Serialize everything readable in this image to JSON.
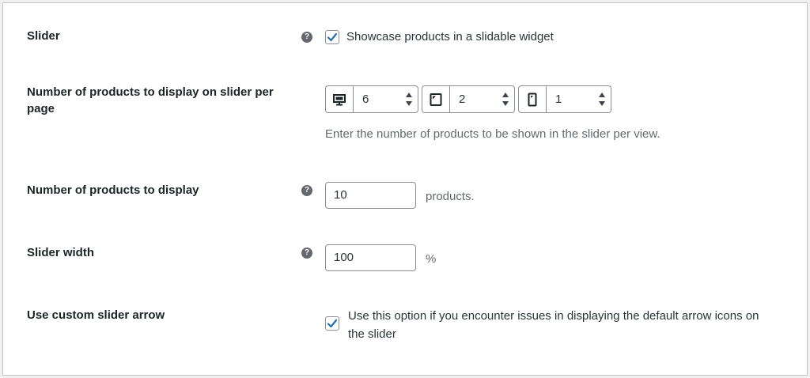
{
  "slider": {
    "label": "Slider",
    "help_glyph": "?",
    "checked": true,
    "checkbox_label": "Showcase products in a slidable widget"
  },
  "per_page": {
    "label": "Number of products to display on slider per page",
    "desktop": {
      "icon": "desktop-icon",
      "value": "6"
    },
    "tablet": {
      "icon": "tablet-icon",
      "value": "2"
    },
    "mobile": {
      "icon": "mobile-icon",
      "value": "1"
    },
    "description": "Enter the number of products to be shown in the slider per view."
  },
  "products_count": {
    "label": "Number of products to display",
    "help_glyph": "?",
    "value": "10",
    "suffix": "products."
  },
  "slider_width": {
    "label": "Slider width",
    "help_glyph": "?",
    "value": "100",
    "suffix": "%"
  },
  "custom_arrow": {
    "label": "Use custom slider arrow",
    "checked": true,
    "description": "Use this option if you encounter issues in displaying the default arrow icons on the slider"
  },
  "colors": {
    "checkmark": "#2271b1",
    "border": "#8c8f94",
    "help_bg": "#646970"
  }
}
